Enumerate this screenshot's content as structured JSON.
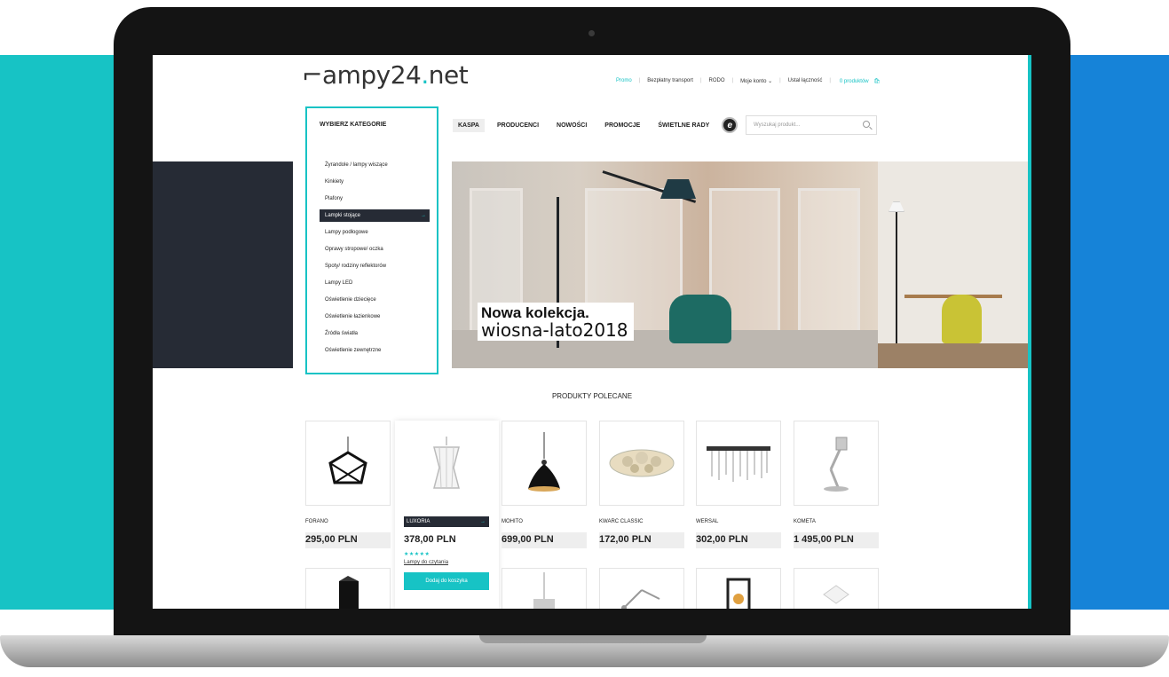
{
  "logo": {
    "prefix": "ampy24",
    "dot": ".",
    "suffix": "net"
  },
  "topnav": {
    "items": [
      "Promo",
      "Bezpłatny transport",
      "RODO",
      "Moje konto ⌄",
      "Ustal łączność",
      "0 produktów"
    ],
    "active_index": 0
  },
  "categories": {
    "title": "WYBIERZ KATEGORIE",
    "items": [
      "Żyrandole / lampy wiszące",
      "Kinkiety",
      "Plafony",
      "Lampki stojące",
      "Lampy podłogowe",
      "Oprawy stropowe/ oczka",
      "Spoty/ rodziny reflektorów",
      "Lampy LED",
      "Oświetlenie dziecięce",
      "Oświetlenie łazienkowe",
      "Źródła światła",
      "Oświetlenie zewnętrzne"
    ],
    "active_index": 3,
    "active_arrow": "→"
  },
  "mainnav": {
    "tabs": [
      "KASPA",
      "PRODUCENCI",
      "NOWOŚCI",
      "PROMOCJE",
      "ŚWIETLNE RADY"
    ],
    "active_index": 0,
    "emblem": "e"
  },
  "search": {
    "placeholder": "Wyszukaj produkt..."
  },
  "hero": {
    "line1": "Nowa kolekcja.",
    "line2": "wiosna-lato2018"
  },
  "featured": {
    "title": "PRODUKTY POLECANE",
    "products": [
      {
        "name": "FORANO",
        "price": "295,00 PLN"
      },
      {
        "name": "LUXORIA",
        "price": "378,00 PLN",
        "stars": "★★★★★",
        "category_link": "Lampy do czytania",
        "add_label": "Dodaj do koszyka",
        "arrow": "→"
      },
      {
        "name": "MOHITO",
        "price": "699,00 PLN"
      },
      {
        "name": "KWARC CLASSIC",
        "price": "172,00 PLN"
      },
      {
        "name": "WERSAL",
        "price": "302,00 PLN"
      },
      {
        "name": "KOMETA",
        "price": "1 495,00 PLN"
      }
    ]
  },
  "colors": {
    "accent": "#17c3c5",
    "dark": "#262b35",
    "bg_left": "#17c3c5",
    "bg_right": "#1683d8"
  }
}
